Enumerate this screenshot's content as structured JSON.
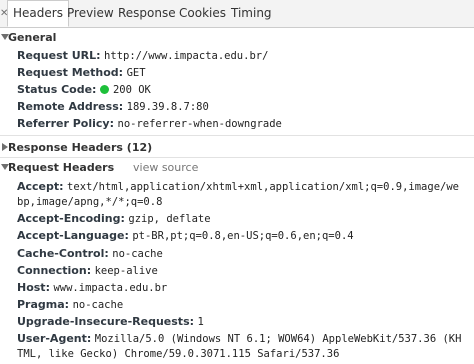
{
  "tabs": [
    {
      "label": "Headers",
      "selected": true
    },
    {
      "label": "Preview",
      "selected": false
    },
    {
      "label": "Response",
      "selected": false
    },
    {
      "label": "Cookies",
      "selected": false
    },
    {
      "label": "Timing",
      "selected": false
    }
  ],
  "general": {
    "title": "General",
    "rows": [
      {
        "key": "Request URL:",
        "value": "http://www.impacta.edu.br/"
      },
      {
        "key": "Request Method:",
        "value": "GET"
      },
      {
        "key": "Status Code:",
        "value": "200 OK"
      },
      {
        "key": "Remote Address:",
        "value": "189.39.8.7:80"
      },
      {
        "key": "Referrer Policy:",
        "value": "no-referrer-when-downgrade"
      }
    ],
    "status_color": "#1ec03a"
  },
  "response_headers": {
    "title": "Response Headers (12)"
  },
  "request_headers": {
    "title": "Request Headers",
    "view_source": "view source",
    "rows": [
      {
        "key": "Accept:",
        "value": "text/html,application/xhtml+xml,application/xml;q=0.9,image/we",
        "cont": "bp,image/apng,*/*;q=0.8"
      },
      {
        "key": "Accept-Encoding:",
        "value": "gzip, deflate"
      },
      {
        "key": "Accept-Language:",
        "value": "pt-BR,pt;q=0.8,en-US;q=0.6,en;q=0.4"
      },
      {
        "key": "Cache-Control:",
        "value": "no-cache"
      },
      {
        "key": "Connection:",
        "value": "keep-alive"
      },
      {
        "key": "Host:",
        "value": "www.impacta.edu.br"
      },
      {
        "key": "Pragma:",
        "value": "no-cache"
      },
      {
        "key": "Upgrade-Insecure-Requests:",
        "value": "1"
      },
      {
        "key": "User-Agent:",
        "value": "Mozilla/5.0 (Windows NT 6.1; WOW64) AppleWebKit/537.36 (KH",
        "cont": "TML, like Gecko) Chrome/59.0.3071.115 Safari/537.36"
      }
    ]
  }
}
